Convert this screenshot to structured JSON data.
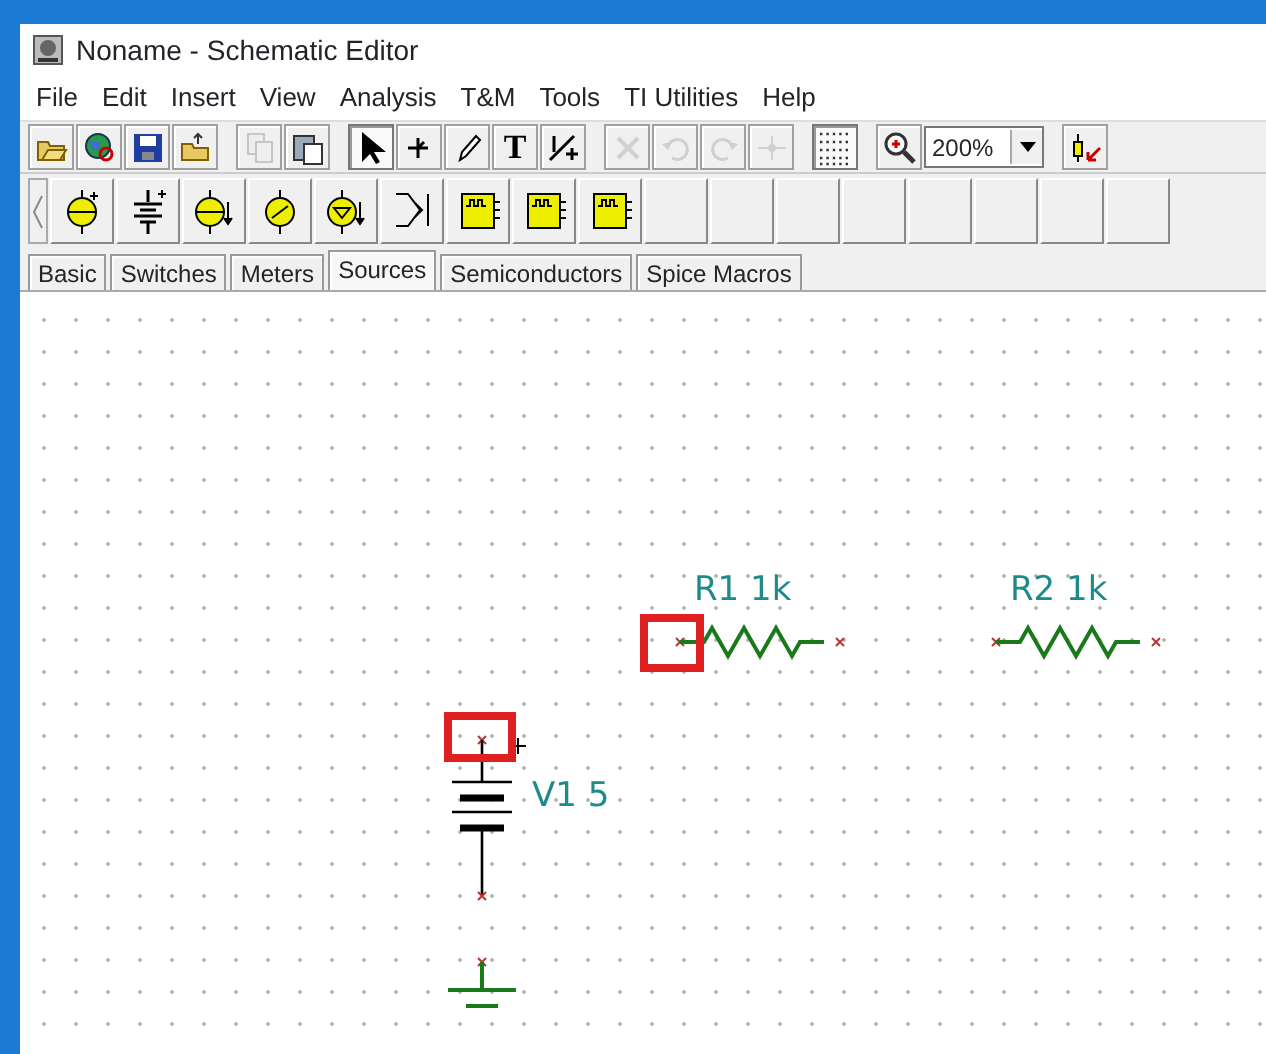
{
  "window": {
    "title": "Noname - Schematic Editor"
  },
  "menu": [
    "File",
    "Edit",
    "Insert",
    "View",
    "Analysis",
    "T&M",
    "Tools",
    "TI Utilities",
    "Help"
  ],
  "toolbar": [
    {
      "kind": "icon",
      "disabled": false,
      "pressed": false
    },
    {
      "kind": "icon",
      "disabled": false,
      "pressed": false
    },
    {
      "kind": "icon",
      "disabled": false,
      "pressed": false
    },
    {
      "kind": "icon",
      "disabled": false,
      "pressed": false
    },
    {
      "kind": "gap"
    },
    {
      "kind": "icon",
      "disabled": true,
      "pressed": false
    },
    {
      "kind": "icon",
      "disabled": false,
      "pressed": false
    },
    {
      "kind": "gap"
    },
    {
      "kind": "icon",
      "disabled": false,
      "pressed": true
    },
    {
      "kind": "icon",
      "disabled": false,
      "pressed": false
    },
    {
      "kind": "icon",
      "disabled": false,
      "pressed": false
    },
    {
      "kind": "text",
      "label": "T",
      "disabled": false,
      "pressed": false
    },
    {
      "kind": "icon",
      "disabled": false,
      "pressed": false
    },
    {
      "kind": "gap"
    },
    {
      "kind": "icon",
      "disabled": true,
      "pressed": false
    },
    {
      "kind": "icon",
      "disabled": true,
      "pressed": false
    },
    {
      "kind": "icon",
      "disabled": true,
      "pressed": false
    },
    {
      "kind": "icon",
      "disabled": true,
      "pressed": false
    },
    {
      "kind": "gap"
    },
    {
      "kind": "icon",
      "disabled": false,
      "pressed": true
    },
    {
      "kind": "gap"
    },
    {
      "kind": "icon",
      "disabled": false,
      "pressed": false
    },
    {
      "kind": "select",
      "value": "200%"
    },
    {
      "kind": "gap"
    },
    {
      "kind": "icon",
      "disabled": false,
      "pressed": false
    }
  ],
  "palette": [
    {
      "kind": "source"
    },
    {
      "kind": "battery"
    },
    {
      "kind": "current"
    },
    {
      "kind": "ac"
    },
    {
      "kind": "controlled"
    },
    {
      "kind": "switch"
    },
    {
      "kind": "macro"
    },
    {
      "kind": "macro"
    },
    {
      "kind": "macro"
    },
    {
      "kind": "empty"
    },
    {
      "kind": "empty"
    },
    {
      "kind": "empty"
    },
    {
      "kind": "empty"
    },
    {
      "kind": "empty"
    },
    {
      "kind": "empty"
    },
    {
      "kind": "empty"
    },
    {
      "kind": "empty"
    }
  ],
  "tabs": [
    {
      "label": "Basic",
      "selected": false
    },
    {
      "label": "Switches",
      "selected": false
    },
    {
      "label": "Meters",
      "selected": false
    },
    {
      "label": "Sources",
      "selected": true
    },
    {
      "label": "Semiconductors",
      "selected": false
    },
    {
      "label": "Spice Macros",
      "selected": false
    }
  ],
  "schematic": [
    {
      "kind": "resistor",
      "label": "R1 1k",
      "highlighted": true
    },
    {
      "kind": "resistor",
      "label": "R2 1k",
      "highlighted": false
    },
    {
      "kind": "battery",
      "label": "V1 5",
      "highlighted": true
    },
    {
      "kind": "ground"
    }
  ]
}
